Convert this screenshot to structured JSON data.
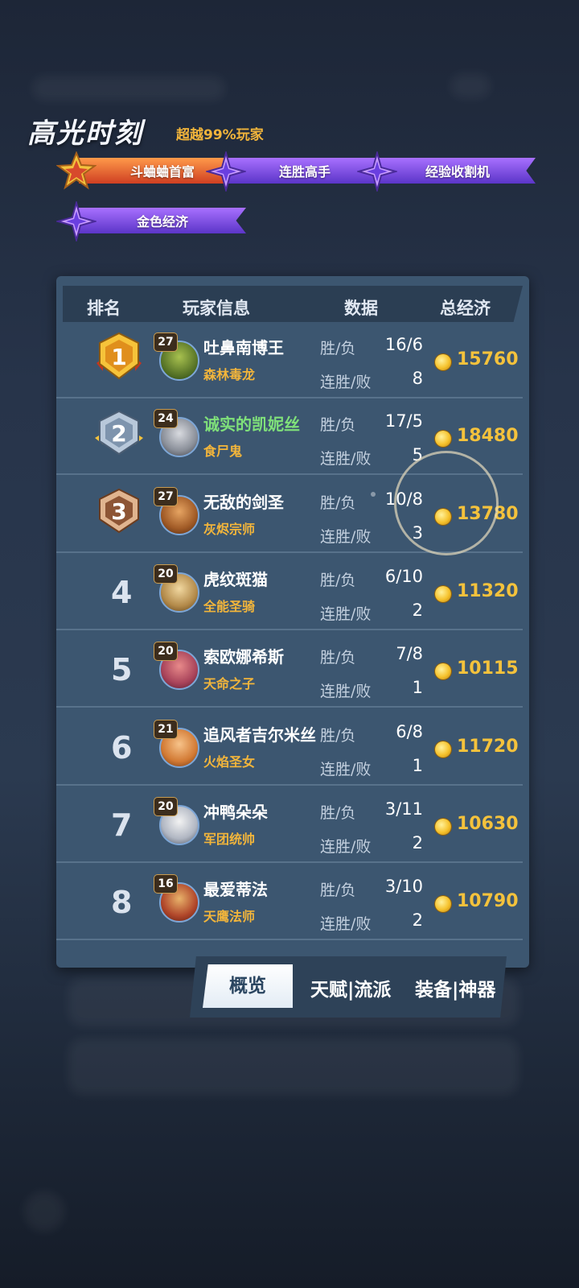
{
  "highlight": {
    "title": "高光时刻",
    "subtitle": "超越99%玩家",
    "badges": [
      {
        "label": "斗蛐蛐首富",
        "style": "gold"
      },
      {
        "label": "连胜高手",
        "style": "purple"
      },
      {
        "label": "经验收割机",
        "style": "purple"
      },
      {
        "label": "金色经济",
        "style": "purple"
      }
    ]
  },
  "table": {
    "headers": [
      "排名",
      "玩家信息",
      "数据",
      "总经济"
    ],
    "stat_label_wl": "胜/负",
    "stat_label_streak": "连胜/败",
    "rows": [
      {
        "rank": "1",
        "level": "27",
        "name": "吐鼻南博王",
        "class": "森林毒龙",
        "wl": "16/6",
        "streak": "8",
        "total": "15760"
      },
      {
        "rank": "2",
        "level": "24",
        "name": "诚实的凯妮丝",
        "class": "食尸鬼",
        "wl": "17/5",
        "streak": "5",
        "total": "18480",
        "highlight_name": true
      },
      {
        "rank": "3",
        "level": "27",
        "name": "无敌的剑圣",
        "class": "灰烬宗师",
        "wl": "10/8",
        "streak": "3",
        "total": "13780"
      },
      {
        "rank": "4",
        "level": "20",
        "name": "虎纹斑猫",
        "class": "全能圣骑",
        "wl": "6/10",
        "streak": "2",
        "total": "11320"
      },
      {
        "rank": "5",
        "level": "20",
        "name": "索欧娜希斯",
        "class": "天命之子",
        "wl": "7/8",
        "streak": "1",
        "total": "10115"
      },
      {
        "rank": "6",
        "level": "21",
        "name": "追风者吉尔米丝",
        "class": "火焰圣女",
        "wl": "6/8",
        "streak": "1",
        "total": "11720"
      },
      {
        "rank": "7",
        "level": "20",
        "name": "冲鸭朵朵",
        "class": "军团统帅",
        "wl": "3/11",
        "streak": "2",
        "total": "10630"
      },
      {
        "rank": "8",
        "level": "16",
        "name": "最爱蒂法",
        "class": "天鹰法师",
        "wl": "3/10",
        "streak": "2",
        "total": "10790"
      }
    ]
  },
  "tabs": {
    "overview": "概览",
    "talents": "天赋|流派",
    "equipment": "装备|神器",
    "active": "概览"
  },
  "colors": {
    "gold_text": "#f2b53b",
    "coin_value": "#f4c23c",
    "panel": "#3c5670",
    "highlight_name": "#7fe07a"
  }
}
